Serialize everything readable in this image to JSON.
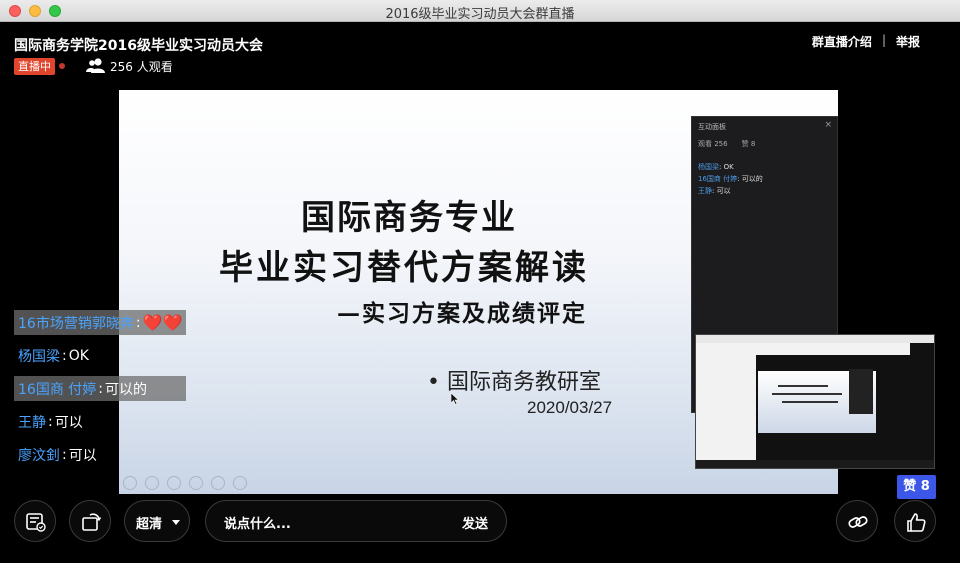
{
  "window": {
    "title": "2016级毕业实习动员大会群直播"
  },
  "header": {
    "room_title": "国际商务学院2016级毕业实习动员大会",
    "live_badge": "直播中",
    "viewers": "256 人观看",
    "intro_link": "群直播介绍",
    "separator": "|",
    "report_link": "举报"
  },
  "slide": {
    "title_line1": "国际商务专业",
    "title_line2": "毕业实习替代方案解读",
    "subtitle": "—实习方案及成绩评定",
    "bullet": "• 国际商务教研室",
    "date": "2020/03/27"
  },
  "panel": {
    "title": "互动面板",
    "close": "×",
    "viewers": "观看 256",
    "likes": "赞 8",
    "messages": [
      {
        "name": "杨国梁",
        "text": ": OK"
      },
      {
        "name": "16国商 付婷",
        "text": ": 可以的"
      },
      {
        "name": "王静",
        "text": ": 可以"
      }
    ]
  },
  "chat": [
    {
      "name": "16市场营销郭晓奔",
      "sep": " : ",
      "text": "❤️❤️",
      "boxed": true
    },
    {
      "name": "杨国梁",
      "sep": " : ",
      "text": "OK",
      "boxed": false
    },
    {
      "name": "16国商 付婷",
      "sep": " : ",
      "text": "可以的",
      "boxed": true
    },
    {
      "name": "王静",
      "sep": " : ",
      "text": "可以",
      "boxed": false
    },
    {
      "name": "廖汶釗",
      "sep": " : ",
      "text": "可以",
      "boxed": false
    }
  ],
  "likes_badge": "赞 8",
  "controls": {
    "quality": "超清",
    "input_placeholder": "说点什么...",
    "send": "发送"
  },
  "colors": {
    "live_badge": "#e0462e",
    "chat_name": "#4aa3ff",
    "likes_badge": "#3c57e8",
    "background": "#000000"
  }
}
